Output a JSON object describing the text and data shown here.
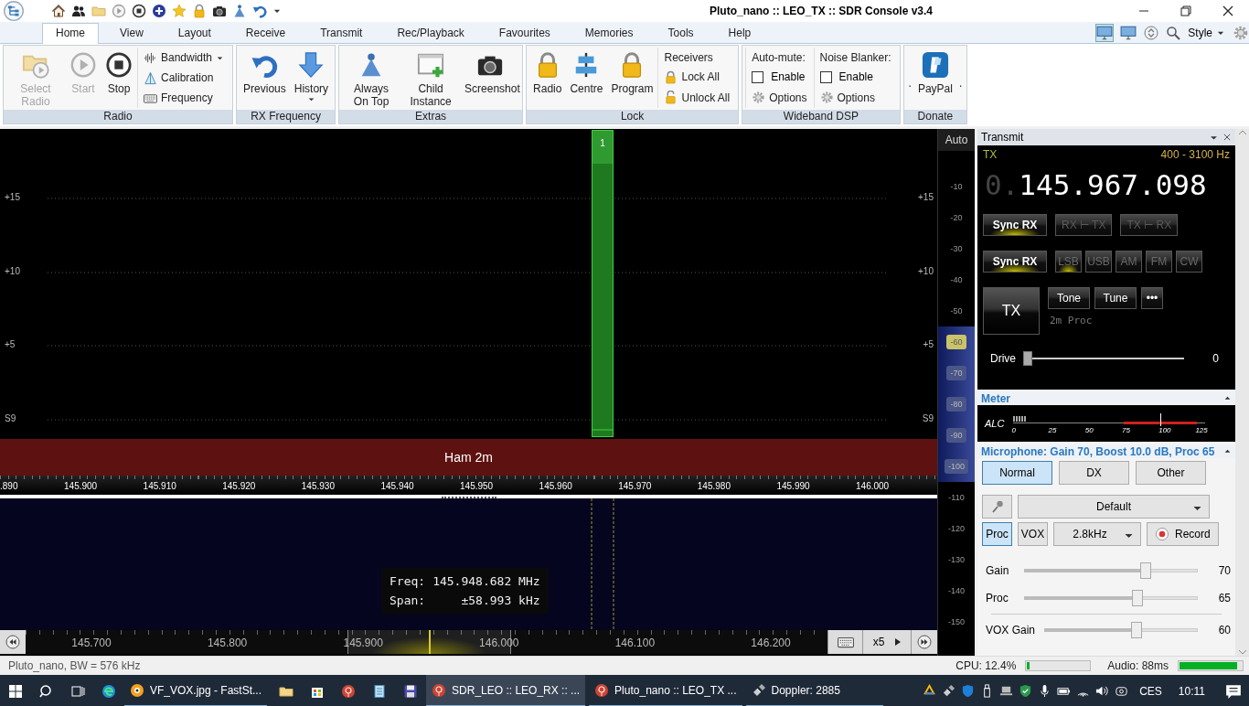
{
  "title_bar": {
    "title": "Pluto_nano :: LEO_TX :: SDR Console v3.4"
  },
  "ribbon": {
    "tabs": [
      {
        "label": "Home",
        "selected": true
      },
      {
        "label": "View",
        "selected": false
      },
      {
        "label": "Layout",
        "selected": false
      },
      {
        "label": "Receive",
        "selected": false
      },
      {
        "label": "Transmit",
        "selected": false
      },
      {
        "label": "Rec/Playback",
        "selected": false
      },
      {
        "label": "Favourites",
        "selected": false
      },
      {
        "label": "Memories",
        "selected": false
      },
      {
        "label": "Tools",
        "selected": false
      },
      {
        "label": "Help",
        "selected": false
      }
    ],
    "style_label": "Style",
    "groups": [
      {
        "title": "Radio",
        "columns": [
          {
            "kind": "large",
            "label": "Select Radio",
            "disabled": true,
            "dropdown": false
          },
          {
            "kind": "large",
            "label": "Start",
            "disabled": true,
            "dropdown": false
          },
          {
            "kind": "large",
            "label": "Stop",
            "disabled": false,
            "dropdown": false
          },
          {
            "kind": "stack",
            "items": [
              {
                "kind": "small",
                "label": "Bandwidth",
                "dropdown": true
              },
              {
                "kind": "small",
                "label": "Calibration",
                "dropdown": false
              },
              {
                "kind": "small",
                "label": "Frequency",
                "dropdown": false
              }
            ]
          }
        ]
      },
      {
        "title": "RX Frequency",
        "columns": [
          {
            "kind": "large",
            "label": "Previous",
            "disabled": false,
            "dropdown": false
          },
          {
            "kind": "large",
            "label": "History",
            "disabled": false,
            "dropdown": true
          }
        ]
      },
      {
        "title": "Extras",
        "columns": [
          {
            "kind": "large",
            "label": "Always On Top",
            "disabled": false,
            "dropdown": false
          },
          {
            "kind": "large",
            "label": "Child Instance",
            "disabled": false,
            "dropdown": false
          },
          {
            "kind": "large",
            "label": "Screenshot",
            "disabled": false,
            "dropdown": false
          }
        ]
      },
      {
        "title": "Lock",
        "columns": [
          {
            "kind": "large",
            "label": "Radio",
            "disabled": false,
            "dropdown": false
          },
          {
            "kind": "large",
            "label": "Centre",
            "disabled": false,
            "dropdown": false
          },
          {
            "kind": "large",
            "label": "Program",
            "disabled": false,
            "dropdown": false
          },
          {
            "kind": "stack",
            "items": [
              {
                "kind": "heading",
                "label": "Receivers"
              },
              {
                "kind": "small",
                "label": "Lock All",
                "dropdown": false
              },
              {
                "kind": "small",
                "label": "Unlock All",
                "dropdown": false
              }
            ]
          }
        ]
      },
      {
        "title": "Wideband DSP",
        "columns": [
          {
            "kind": "stack",
            "items": [
              {
                "kind": "heading",
                "label": "Auto-mute:"
              },
              {
                "kind": "check",
                "label": "Enable",
                "checked": false
              },
              {
                "kind": "small",
                "label": "Options",
                "dropdown": false
              }
            ]
          },
          {
            "kind": "stack",
            "items": [
              {
                "kind": "heading",
                "label": "Noise Blanker:"
              },
              {
                "kind": "check",
                "label": "Enable",
                "checked": false
              },
              {
                "kind": "small",
                "label": "Options",
                "dropdown": false
              }
            ]
          }
        ]
      },
      {
        "title": "Donate",
        "columns": [
          {
            "kind": "mark",
            "label": "."
          },
          {
            "kind": "large",
            "label": "PayPal",
            "disabled": false,
            "dropdown": false
          },
          {
            "kind": "mark",
            "label": "."
          }
        ]
      }
    ]
  },
  "spectrum": {
    "levels_left": [
      "+15",
      "+10",
      "+5",
      "S9"
    ],
    "levels_right": [
      "+15",
      "+10",
      "+5",
      "S9"
    ],
    "signal_marker": "1",
    "band": "Ham 2m",
    "ruler": [
      ".890",
      "145.900",
      "145.910",
      "145.920",
      "145.930",
      "145.940",
      "145.950",
      "145.960",
      "145.970",
      "145.980",
      "145.990",
      "146.000"
    ]
  },
  "waterfall": {
    "readout": [
      {
        "label": "Freq:",
        "value": "145.948.682 MHz"
      },
      {
        "label": "Span:",
        "value": "±58.993 kHz"
      }
    ]
  },
  "overview": {
    "ruler": [
      "145.700",
      "145.800",
      "145.900",
      "146.000",
      "146.100",
      "146.200"
    ],
    "zoom": "x5"
  },
  "db_scale": {
    "mode": "Auto",
    "marks": [
      {
        "label": "-10",
        "in_range": false,
        "selected": false
      },
      {
        "label": "-20",
        "in_range": false,
        "selected": false
      },
      {
        "label": "-30",
        "in_range": false,
        "selected": false
      },
      {
        "label": "-40",
        "in_range": false,
        "selected": false
      },
      {
        "label": "-50",
        "in_range": false,
        "selected": false
      },
      {
        "label": "-60",
        "in_range": true,
        "selected": true
      },
      {
        "label": "-70",
        "in_range": true,
        "selected": false
      },
      {
        "label": "-80",
        "in_range": true,
        "selected": false
      },
      {
        "label": "-90",
        "in_range": true,
        "selected": false
      },
      {
        "label": "-100",
        "in_range": true,
        "selected": false
      },
      {
        "label": "-110",
        "in_range": false,
        "selected": false
      },
      {
        "label": "-120",
        "in_range": false,
        "selected": false
      },
      {
        "label": "-130",
        "in_range": false,
        "selected": false
      },
      {
        "label": "-140",
        "in_range": false,
        "selected": false
      },
      {
        "label": "-150",
        "in_range": false,
        "selected": false
      }
    ]
  },
  "transmit": {
    "title": "Transmit",
    "mode_label": "TX",
    "filter": "400 - 3100 Hz",
    "frequency_prefix": "0.",
    "frequency": "145.967.098",
    "sync_buttons": [
      {
        "label": "Sync RX",
        "on": true,
        "disabled": false
      },
      {
        "label": "RX ⊢ TX",
        "on": false,
        "disabled": true
      },
      {
        "label": "TX ⊢ RX",
        "on": false,
        "disabled": true
      }
    ],
    "mode_sync": {
      "label": "Sync RX",
      "on": true
    },
    "modes": [
      {
        "label": "LSB",
        "selected": true
      },
      {
        "label": "USB",
        "selected": false
      },
      {
        "label": "AM",
        "selected": false
      },
      {
        "label": "FM",
        "selected": false
      },
      {
        "label": "CW",
        "selected": false
      }
    ],
    "tx_button": "TX",
    "actions": [
      "Tone",
      "Tune",
      "•••"
    ],
    "profile": "2m Proc",
    "drive": {
      "label": "Drive",
      "level": 0,
      "reading": "0"
    }
  },
  "meter": {
    "title": "Meter",
    "label": "ALC",
    "scale": [
      "0",
      "25",
      "50",
      "75",
      "100",
      "125"
    ],
    "level": 0.07
  },
  "microphone": {
    "title": "Microphone: Gain 70, Boost 10.0 dB, Proc 65",
    "presets": [
      {
        "label": "Normal",
        "selected": true
      },
      {
        "label": "DX",
        "selected": false
      },
      {
        "label": "Other",
        "selected": false
      }
    ],
    "device": "Default",
    "toggles": [
      {
        "label": "Proc",
        "on": true
      },
      {
        "label": "VOX",
        "on": false
      }
    ],
    "bandwidth": "2.8kHz",
    "record": "Record",
    "sliders": [
      {
        "label": "Gain",
        "level": 0.7,
        "reading": "70"
      },
      {
        "label": "Proc",
        "level": 0.65,
        "reading": "65"
      },
      {
        "label": "VOX Gain",
        "level": 0.6,
        "reading": "60"
      }
    ]
  },
  "status_bar": {
    "text": "Pluto_nano, BW = 576 kHz",
    "cpu": {
      "label": "CPU: 12.4%",
      "level": 0.04
    },
    "audio": {
      "label": "Audio: 88ms",
      "level": 0.93
    }
  },
  "taskbar": {
    "windows": [
      {
        "label": "VF_VOX.jpg  - FastSt...",
        "selected": false
      },
      {
        "label": "SDR_LEO :: LEO_RX :: ...",
        "selected": true
      },
      {
        "label": "Pluto_nano :: LEO_TX ...",
        "selected": false
      },
      {
        "label": "Doppler: 2885",
        "selected": false
      }
    ],
    "language": "CES",
    "time": "10:11"
  }
}
